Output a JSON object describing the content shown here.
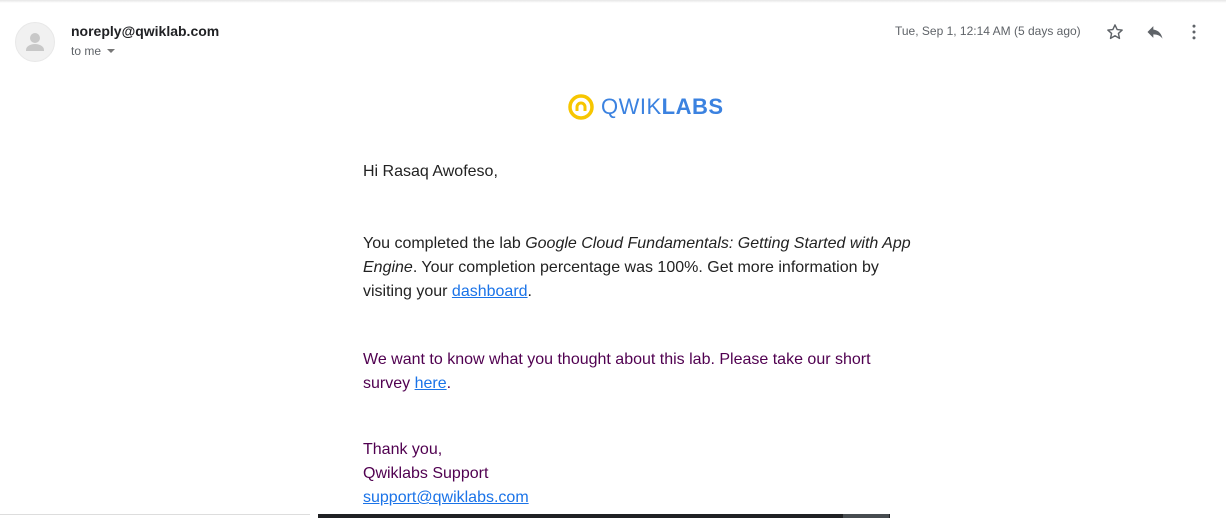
{
  "header": {
    "sender": "noreply@qwiklab.com",
    "recipient_label": "to me",
    "date": "Tue, Sep 1, 12:14 AM (5 days ago)",
    "icons": [
      "star-icon",
      "reply-icon",
      "more-vert-icon"
    ]
  },
  "logo": {
    "part1": "QWIK",
    "part2": "LABS",
    "color": "#3b82e0",
    "icon_color": "#f7c600"
  },
  "email": {
    "greeting": "Hi Rasaq Awofeso,",
    "p1_a": "You completed the lab ",
    "p1_lab": "Google Cloud Fundamentals: Getting Started with App Engine",
    "p1_b": ". Your completion percentage was 100%. Get more information by visiting your ",
    "p1_link": "dashboard",
    "p1_c": ".",
    "p2_a": "We want to know what you thought about this lab. Please take our short survey ",
    "p2_link": "here",
    "p2_b": ".",
    "thanks": "Thank you,",
    "signature": "Qwiklabs Support",
    "support_email": "support@qwiklabs.com"
  }
}
